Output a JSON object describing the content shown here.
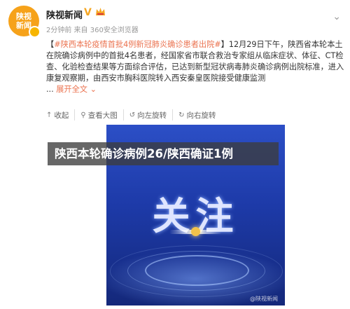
{
  "account": {
    "avatar_text": [
      "陕视",
      "新闻"
    ],
    "name": "陕视新闻",
    "meta": "2分钟前 来自 360安全浏览器"
  },
  "post": {
    "bracket_open": "【",
    "hashtag": "#陕西本轮疫情首批4例新冠肺炎确诊患者出院#",
    "bracket_close": "】",
    "body": "12月29日下午，陕西省本轮本土在院确诊病例中的首批4名患者，经国家省市联合救治专家组从临床症状、体征、CT检查、化验检查结果等方面综合评估，已达到新型冠状病毒肺炎确诊病例出院标准，进入康复观察期，由西安市胸科医院转入西安秦皇医院接受健康监测",
    "ellipsis": "...",
    "expand_label": "展开全文",
    "expand_icon": "chevron-down-icon"
  },
  "toolbar": {
    "collect": "收起",
    "view_large": "查看大图",
    "rotate_left": "向左旋转",
    "rotate_right": "向右旋转"
  },
  "image": {
    "main_text": "关注",
    "watermark": "@陕视新闻"
  },
  "headline": "陕西本轮确诊病例26/陕西确证1例",
  "colors": {
    "accent": "#eb7350",
    "verified": "#f5a623",
    "avatar_bg": "#f6a21a",
    "poster_blue": "#1d3aa8"
  }
}
